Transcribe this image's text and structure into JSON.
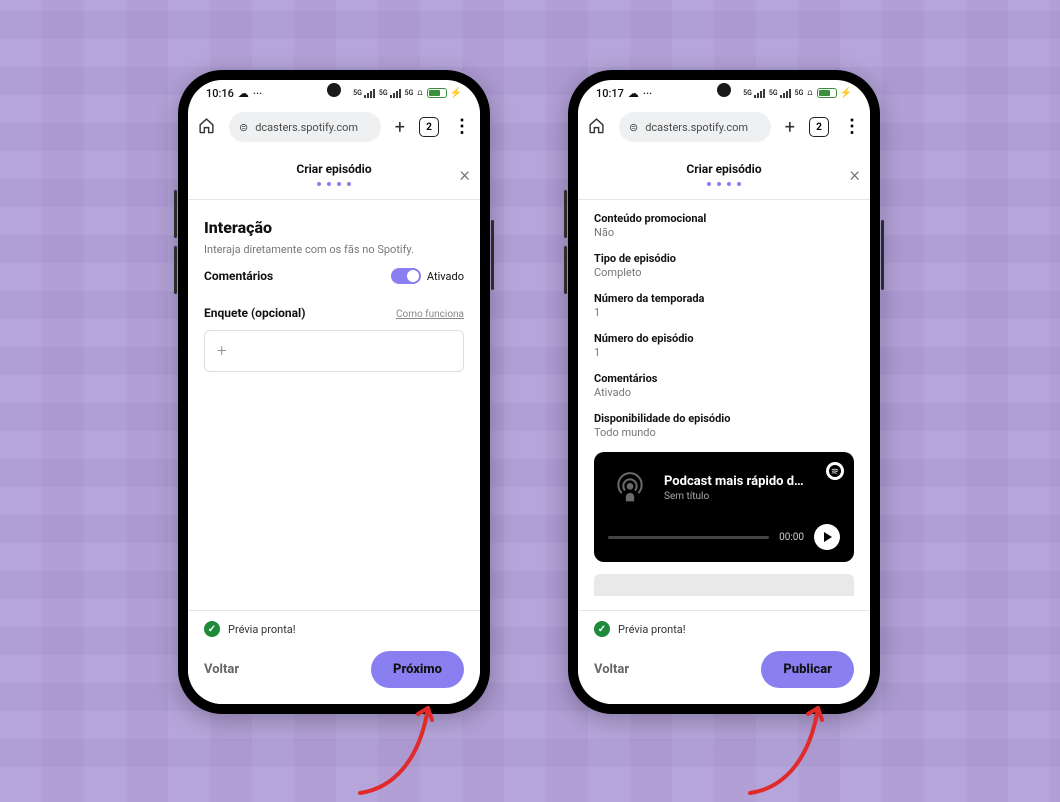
{
  "background_color": "#b19fd8",
  "phones": {
    "left": {
      "statusbar": {
        "time": "10:16",
        "cloud_glyph": "☁",
        "more_glyph": "···",
        "net_label": "5G",
        "battery_pct": "60"
      },
      "browser": {
        "url_text": "dcasters.spotify.com",
        "lock_glyph": "🔒",
        "tab_count": "2"
      },
      "page_header": {
        "title": "Criar episódio"
      },
      "content": {
        "section_title": "Interação",
        "section_subtitle": "Interaja diretamente com os fãs no Spotify.",
        "comments_label": "Comentários",
        "comments_status": "Ativado",
        "poll_label": "Enquete (opcional)",
        "how_link": "Como funciona",
        "add_glyph": "+"
      },
      "footer": {
        "preview_text": "Prévia pronta!",
        "back_label": "Voltar",
        "primary_label": "Próximo"
      }
    },
    "right": {
      "statusbar": {
        "time": "10:17",
        "cloud_glyph": "☁",
        "more_glyph": "···",
        "net_label": "5G",
        "battery_pct": "60"
      },
      "browser": {
        "url_text": "dcasters.spotify.com",
        "lock_glyph": "🔒",
        "tab_count": "2"
      },
      "page_header": {
        "title": "Criar episódio"
      },
      "content": {
        "rows": [
          {
            "k": "Conteúdo promocional",
            "v": "Não"
          },
          {
            "k": "Tipo de episódio",
            "v": "Completo"
          },
          {
            "k": "Número da temporada",
            "v": "1"
          },
          {
            "k": "Número do episódio",
            "v": "1"
          },
          {
            "k": "Comentários",
            "v": "Ativado"
          },
          {
            "k": "Disponibilidade do episódio",
            "v": "Todo mundo"
          }
        ],
        "player": {
          "title": "Podcast mais rápido d…",
          "subtitle": "Sem título",
          "time": "00:00"
        }
      },
      "footer": {
        "preview_text": "Prévia pronta!",
        "back_label": "Voltar",
        "primary_label": "Publicar"
      }
    }
  }
}
